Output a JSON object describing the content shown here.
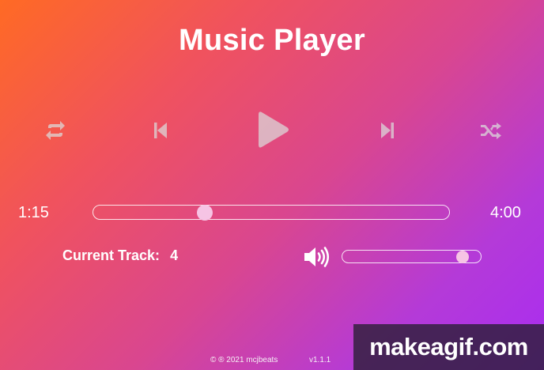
{
  "app": {
    "title": "Music Player"
  },
  "controls": {
    "repeat_icon": "repeat-icon",
    "previous_icon": "skip-previous-icon",
    "play_icon": "play-icon",
    "next_icon": "skip-next-icon",
    "shuffle_icon": "shuffle-icon"
  },
  "progress": {
    "current_time": "1:15",
    "total_time": "4:00",
    "fraction": 0.3125
  },
  "track": {
    "label": "Current Track:",
    "number": "4"
  },
  "volume": {
    "icon": "volume-icon",
    "level": 0.87
  },
  "footer": {
    "copyright": "© ® 2021 mcjbeats",
    "version": "v1.1.1"
  },
  "watermark": {
    "text": "makeagif.com"
  },
  "colors": {
    "gradient_start": "#ff6a24",
    "gradient_end": "#a92cf2",
    "knob": "#f6c4e4",
    "icon": "#dcdcdc"
  }
}
